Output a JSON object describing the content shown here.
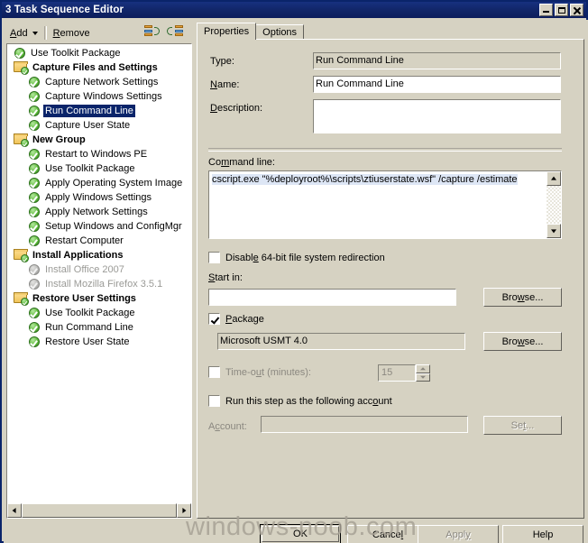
{
  "window": {
    "title": "3 Task Sequence Editor",
    "minimize_label": "minimize",
    "maximize_label": "maximize",
    "close_label": "close"
  },
  "toolbar": {
    "add_label": "Add",
    "remove_label": "Remove",
    "move_up_icon": "move-up-icon",
    "move_down_icon": "move-down-icon"
  },
  "tree": {
    "items": [
      {
        "label": "Use Toolkit Package",
        "indent": 1,
        "type": "step",
        "state": "enabled",
        "selected": false
      },
      {
        "label": "Capture Files and Settings",
        "indent": 0,
        "type": "group",
        "state": "enabled",
        "selected": false
      },
      {
        "label": "Capture Network Settings",
        "indent": 2,
        "type": "step",
        "state": "enabled",
        "selected": false
      },
      {
        "label": "Capture Windows Settings",
        "indent": 2,
        "type": "step",
        "state": "enabled",
        "selected": false
      },
      {
        "label": "Run Command Line",
        "indent": 2,
        "type": "step",
        "state": "enabled",
        "selected": true
      },
      {
        "label": "Capture User State",
        "indent": 2,
        "type": "step",
        "state": "enabled",
        "selected": false
      },
      {
        "label": "New Group",
        "indent": 0,
        "type": "group",
        "state": "enabled",
        "selected": false
      },
      {
        "label": "Restart to Windows PE",
        "indent": 2,
        "type": "step",
        "state": "enabled",
        "selected": false
      },
      {
        "label": "Use Toolkit Package",
        "indent": 2,
        "type": "step",
        "state": "enabled",
        "selected": false
      },
      {
        "label": "Apply Operating System Image",
        "indent": 2,
        "type": "step",
        "state": "enabled",
        "selected": false
      },
      {
        "label": "Apply Windows Settings",
        "indent": 2,
        "type": "step",
        "state": "enabled",
        "selected": false
      },
      {
        "label": "Apply Network Settings",
        "indent": 2,
        "type": "step",
        "state": "enabled",
        "selected": false
      },
      {
        "label": "Setup Windows and ConfigMgr",
        "indent": 2,
        "type": "step",
        "state": "enabled",
        "selected": false
      },
      {
        "label": "Restart Computer",
        "indent": 2,
        "type": "step",
        "state": "enabled",
        "selected": false
      },
      {
        "label": "Install Applications",
        "indent": 0,
        "type": "group",
        "state": "enabled",
        "selected": false
      },
      {
        "label": "Install Office 2007",
        "indent": 2,
        "type": "step",
        "state": "disabled",
        "selected": false
      },
      {
        "label": "Install Mozilla Firefox 3.5.1",
        "indent": 2,
        "type": "step",
        "state": "disabled",
        "selected": false
      },
      {
        "label": "Restore User Settings",
        "indent": 0,
        "type": "group",
        "state": "enabled",
        "selected": false
      },
      {
        "label": "Use Toolkit Package",
        "indent": 2,
        "type": "step",
        "state": "enabled",
        "selected": false
      },
      {
        "label": "Run Command Line",
        "indent": 2,
        "type": "step",
        "state": "enabled",
        "selected": false
      },
      {
        "label": "Restore User State",
        "indent": 2,
        "type": "step",
        "state": "enabled",
        "selected": false
      }
    ]
  },
  "tabs": [
    {
      "label": "Properties",
      "active": true
    },
    {
      "label": "Options",
      "active": false
    }
  ],
  "properties": {
    "type_label": "Type:",
    "type_value": "Run Command Line",
    "name_label": "Name:",
    "name_value": "Run Command Line",
    "description_label": "Description:",
    "description_value": "",
    "command_line_label": "Command line:",
    "command_line_value": "cscript.exe \"%deployroot%\\scripts\\ztiuserstate.wsf\" /capture /estimate",
    "disable_redirection_label": "Disable 64-bit file system redirection",
    "disable_redirection_checked": false,
    "start_in_label": "Start in:",
    "start_in_value": "",
    "start_in_browse_label": "Browse...",
    "package_label": "Package",
    "package_checked": true,
    "package_value": "Microsoft USMT 4.0",
    "package_browse_label": "Browse...",
    "timeout_label": "Time-out (minutes):",
    "timeout_checked": false,
    "timeout_value": "15",
    "run_as_label": "Run this step as the following account",
    "run_as_checked": false,
    "account_label": "Account:",
    "account_value": "",
    "account_set_label": "Set..."
  },
  "footer": {
    "ok_label": "OK",
    "cancel_label": "Cancel",
    "apply_label": "Apply",
    "apply_enabled": false,
    "help_label": "Help"
  },
  "watermark": {
    "text": "windows-noob.com"
  },
  "colors": {
    "titlebar": "#0c1e5c",
    "face": "#d6d2c2",
    "selection": "#0a246a",
    "field": "#ffffff",
    "disabled_text": "#8b8880"
  }
}
